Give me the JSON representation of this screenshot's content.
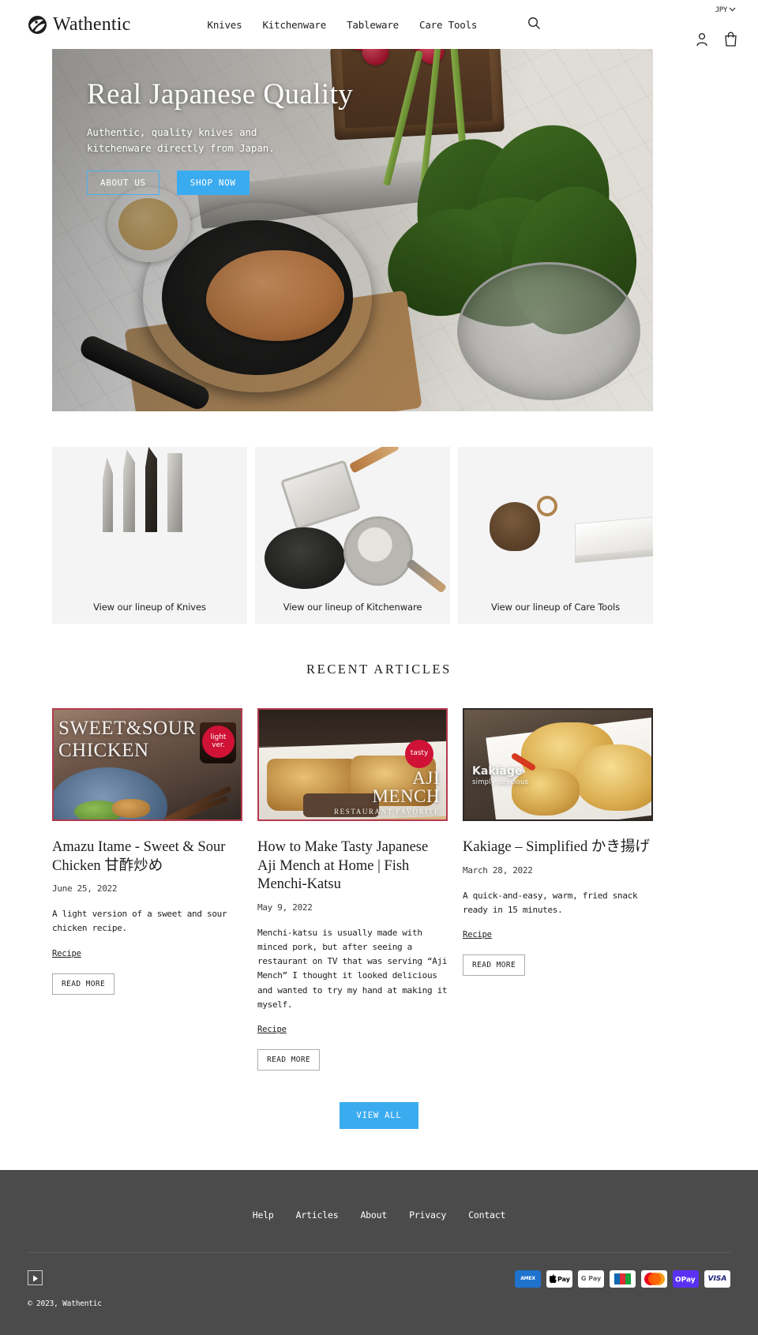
{
  "header": {
    "brand": "Wathentic",
    "nav": [
      {
        "label": "Knives"
      },
      {
        "label": "Kitchenware"
      },
      {
        "label": "Tableware"
      },
      {
        "label": "Care Tools"
      }
    ],
    "currency": "JPY",
    "search_icon": "search-icon",
    "account_icon": "account-icon",
    "cart_icon": "cart-icon"
  },
  "hero": {
    "title": "Real Japanese Quality",
    "subtitle": "Authentic, quality knives and\nkitchenware directly from Japan.",
    "btn_about": "ABOUT US",
    "btn_shop": "SHOP NOW",
    "accent_color": "#3babf0"
  },
  "collections": [
    {
      "label": "View our lineup of Knives"
    },
    {
      "label": "View our lineup of Kitchenware"
    },
    {
      "label": "View our lineup of Care Tools"
    }
  ],
  "articles_section": {
    "heading": "RECENT ARTICLES",
    "view_all": "VIEW ALL",
    "items": [
      {
        "overlay_title": "SWEET&SOUR\nCHICKEN",
        "badge": "light\nver.",
        "title": "Amazu Itame - Sweet & Sour Chicken 甘酢炒め",
        "date": "June 25, 2022",
        "excerpt": "A light version of a sweet and sour chicken recipe.",
        "tag": "Recipe",
        "read_more": "READ MORE"
      },
      {
        "overlay_title": "AJI\nMENCH",
        "overlay_sub": "RESTAURANT FAVORITE",
        "badge": "tasty",
        "title": "How to Make Tasty Japanese Aji Mench at Home | Fish Menchi-Katsu",
        "date": "May 9, 2022",
        "excerpt": "Menchi-katsu is usually made with minced pork, but after seeing a restaurant on TV that was serving “Aji Mench” I thought it looked delicious and wanted to try my hand at making it myself.",
        "tag": "Recipe",
        "read_more": "READ MORE"
      },
      {
        "overlay_title": "Kakiage",
        "overlay_sub": "simply delicious",
        "badge": "",
        "title": "Kakiage – Simplified かき揚げ",
        "date": "March 28, 2022",
        "excerpt": "A quick-and-easy, warm, fried snack ready in 15 minutes.",
        "tag": "Recipe",
        "read_more": "READ MORE"
      }
    ]
  },
  "footer": {
    "nav": [
      {
        "label": "Help"
      },
      {
        "label": "Articles"
      },
      {
        "label": "About"
      },
      {
        "label": "Privacy"
      },
      {
        "label": "Contact"
      }
    ],
    "social_icon": "youtube-play-icon",
    "copyright": "© 2023, Wathentic",
    "payments": [
      {
        "name": "amex",
        "label": "AMEX"
      },
      {
        "name": "apple-pay",
        "label": "Pay"
      },
      {
        "name": "google-pay",
        "label": "G Pay"
      },
      {
        "name": "jcb",
        "label": "JCB"
      },
      {
        "name": "mastercard",
        "label": ""
      },
      {
        "name": "shop-pay",
        "label": "Pay"
      },
      {
        "name": "visa",
        "label": "VISA"
      }
    ]
  }
}
